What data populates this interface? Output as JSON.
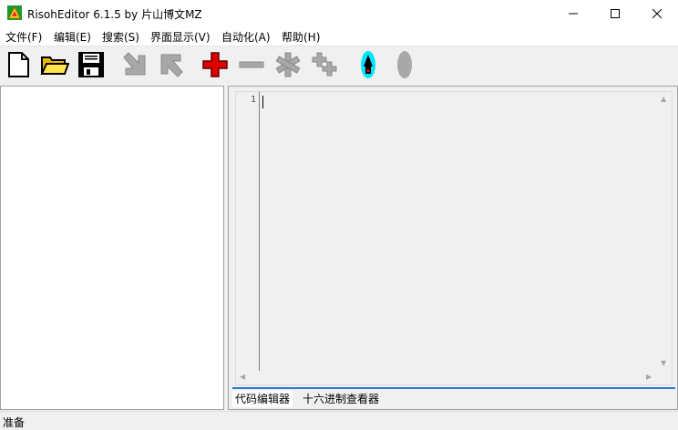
{
  "window": {
    "title": "RisohEditor 6.1.5 by 片山博文MZ",
    "app_icon": "risoh-editor-icon",
    "controls": [
      "minimize-icon",
      "maximize-icon",
      "close-icon"
    ]
  },
  "menubar": {
    "items": [
      {
        "label": "文件(F)"
      },
      {
        "label": "编辑(E)"
      },
      {
        "label": "搜索(S)"
      },
      {
        "label": "界面显示(V)"
      },
      {
        "label": "自动化(A)"
      },
      {
        "label": "帮助(H)"
      }
    ]
  },
  "toolbar": {
    "buttons": [
      "new-file-icon",
      "open-folder-icon",
      "save-icon",
      "import-icon",
      "export-icon",
      "add-icon",
      "delete-icon",
      "clone-icon",
      "copy-icon",
      "compile-icon",
      "test-icon"
    ]
  },
  "editor": {
    "line_numbers": [
      "1"
    ]
  },
  "tabs": [
    {
      "label": "代码编辑器"
    },
    {
      "label": "十六进制查看器"
    }
  ],
  "status": {
    "text": "准备"
  },
  "colors": {
    "accent": "#2b78d4",
    "add_red": "#e00000",
    "compile_cyan": "#00e5ff",
    "disabled_gray": "#a8a8a8"
  }
}
